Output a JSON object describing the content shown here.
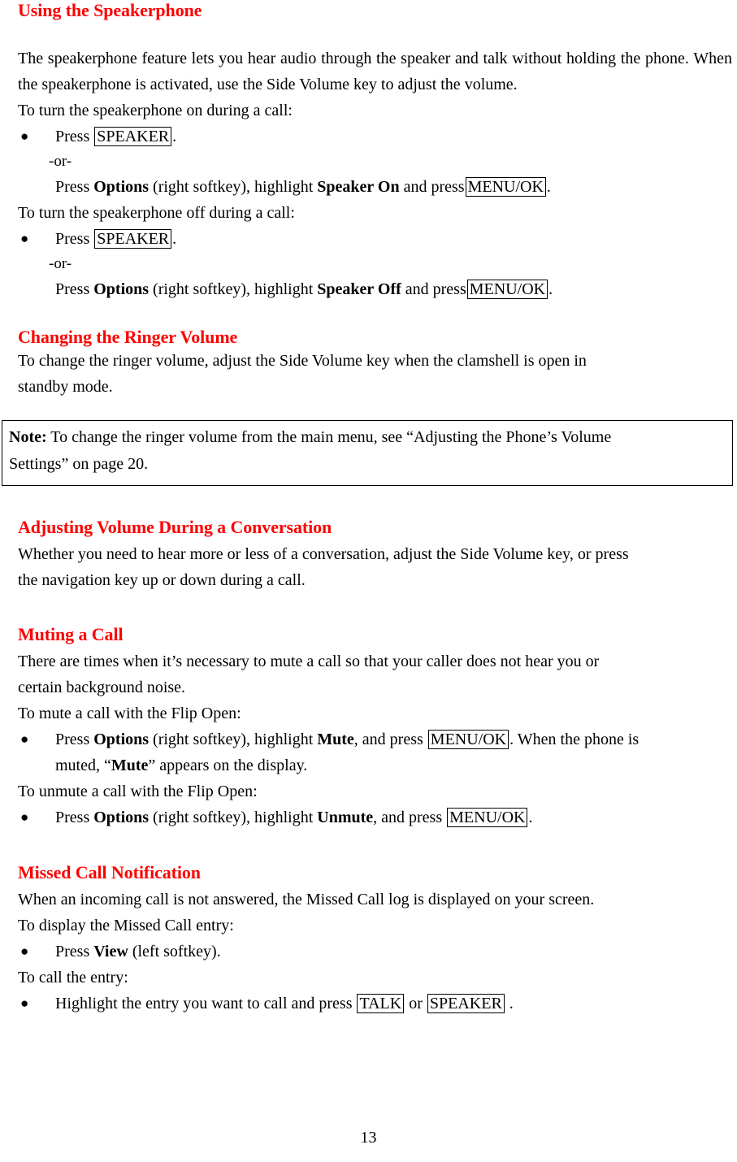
{
  "page": {
    "number": "13"
  },
  "sections": [
    {
      "heading": "Using the Speakerphone",
      "intro": "The speakerphone feature lets you hear audio through the speaker and talk without holding the phone. When the speakerphone is activated, use the Side Volume key to adjust the volume.",
      "lead_on": "To turn the speakerphone on during a call:",
      "bullet_on_press": "Press",
      "key_speaker": "SPEAKER",
      "period": ".",
      "or_label": "-or-",
      "alt_on": {
        "press": "Press",
        "options": "Options",
        "softkey": "(right softkey), highlight",
        "target": "Speaker On",
        "and_press": "and press",
        "key": "MENU/OK",
        "end": "."
      },
      "lead_off": "To turn the speakerphone off during a call:",
      "alt_off": {
        "press": "Press",
        "options": "Options",
        "softkey": "(right softkey), highlight",
        "target": "Speaker Off",
        "and_press": "and press",
        "key": "MENU/OK",
        "end": "."
      }
    },
    {
      "heading": "Changing the Ringer Volume",
      "body_line1": "To change the ringer volume, adjust the Side Volume key when the clamshell is open in",
      "body_line2": "standby mode.",
      "note": {
        "label": "Note:",
        "line1": "To change the ringer volume from the main menu, see “Adjusting the Phone’s Volume",
        "line2": "Settings” on page 20."
      }
    },
    {
      "heading": "Adjusting Volume During a Conversation",
      "body_line1": "Whether you need to hear more or less of a conversation, adjust the Side Volume key, or press",
      "body_line2": "the navigation key up or down during a call."
    },
    {
      "heading": "Muting a Call",
      "intro_line1": "There are times when it’s necessary to mute a call so that your caller does not hear you or",
      "intro_line2": "certain background noise.",
      "lead_mute": "To mute a call with the Flip Open:",
      "mute_bullet": {
        "press": "Press",
        "options": "Options",
        "softkey": "(right softkey), highlight",
        "target": "Mute",
        "and_press": ", and press",
        "key": "MENU/OK",
        "tail": ". When the phone is"
      },
      "mute_bullet_line2": {
        "pre": "muted, “",
        "target": "Mute",
        "post": "” appears on the display."
      },
      "lead_unmute": "To unmute a call with the Flip Open:",
      "unmute_bullet": {
        "press": "Press",
        "options": "Options",
        "softkey": "(right softkey), highlight",
        "target": "Unmute",
        "and_press": ", and press",
        "key": "MENU/OK",
        "tail": "."
      }
    },
    {
      "heading": "Missed Call Notification",
      "body": "When an incoming call is not answered, the Missed Call log is displayed on your screen.",
      "lead_display": "To display the Missed Call entry:",
      "display_bullet": {
        "press": "Press",
        "target": "View",
        "tail": "(left softkey)."
      },
      "lead_call": "To call the entry:",
      "call_bullet": {
        "pre": "Highlight the entry you want to call and press",
        "key_talk": "TALK",
        "or": "or",
        "key_speaker": "SPEAKER",
        "tail": "."
      }
    }
  ],
  "icons": {
    "bullet": "●"
  },
  "colors": {
    "heading": "#ff0000",
    "text": "#000000",
    "border": "#000000",
    "background": "#ffffff"
  }
}
